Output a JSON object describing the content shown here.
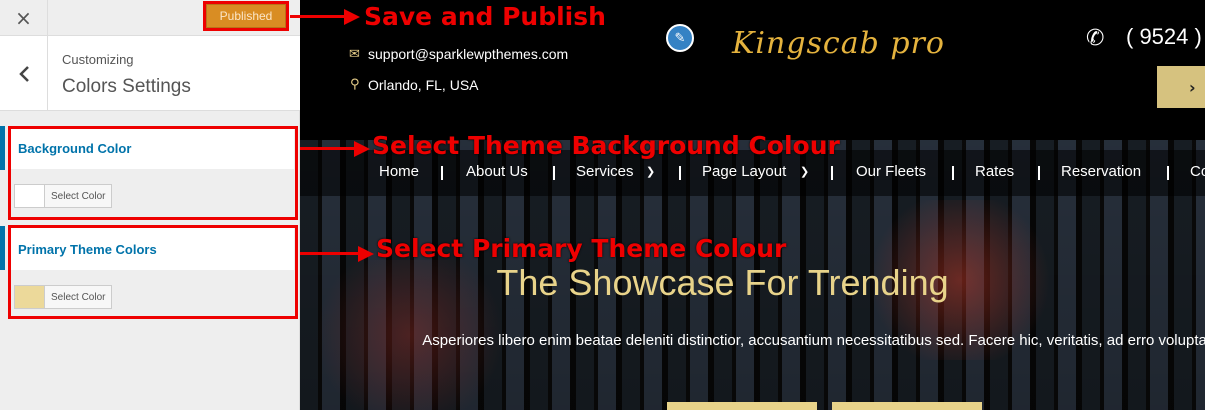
{
  "customizer": {
    "close_icon": "×",
    "publish_label": "Published",
    "back_icon": "‹",
    "breadcrumb": "Customizing",
    "section_title": "Colors Settings",
    "controls": [
      {
        "label": "Background Color",
        "button_label": "Select Color",
        "swatch_color": "#ffffff"
      },
      {
        "label": "Primary Theme Colors",
        "button_label": "Select Color",
        "swatch_color": "#ecd99a"
      }
    ]
  },
  "preview": {
    "email": "support@sparklewpthemes.com",
    "location": "Orlando, FL, USA",
    "logo": "Kingscab pro",
    "phone": "( 9524 )",
    "cta_arrow": "›",
    "nav": [
      "Home",
      "About Us",
      "Services",
      "Page Layout",
      "Our Fleets",
      "Rates",
      "Reservation",
      "Co"
    ],
    "hero_title": "The Showcase For Trending",
    "hero_text": "Asperiores libero enim beatae deleniti distinctior, accusantium necessitatibus sed. Facere hic, veritatis, ad erro voluptate pariatur."
  },
  "annotations": {
    "publish": "Save and Publish",
    "background": "Select Theme Background Colour",
    "primary": "Select Primary Theme Colour"
  },
  "colors": {
    "accent_blue": "#0073aa",
    "publish_orange": "#d98d23",
    "annotation_red": "#ee0000",
    "gold": "#e8d38a"
  },
  "icons": {
    "email": "envelope-icon",
    "location": "map-pin-icon",
    "phone": "phone-icon",
    "edit": "pencil-icon"
  }
}
